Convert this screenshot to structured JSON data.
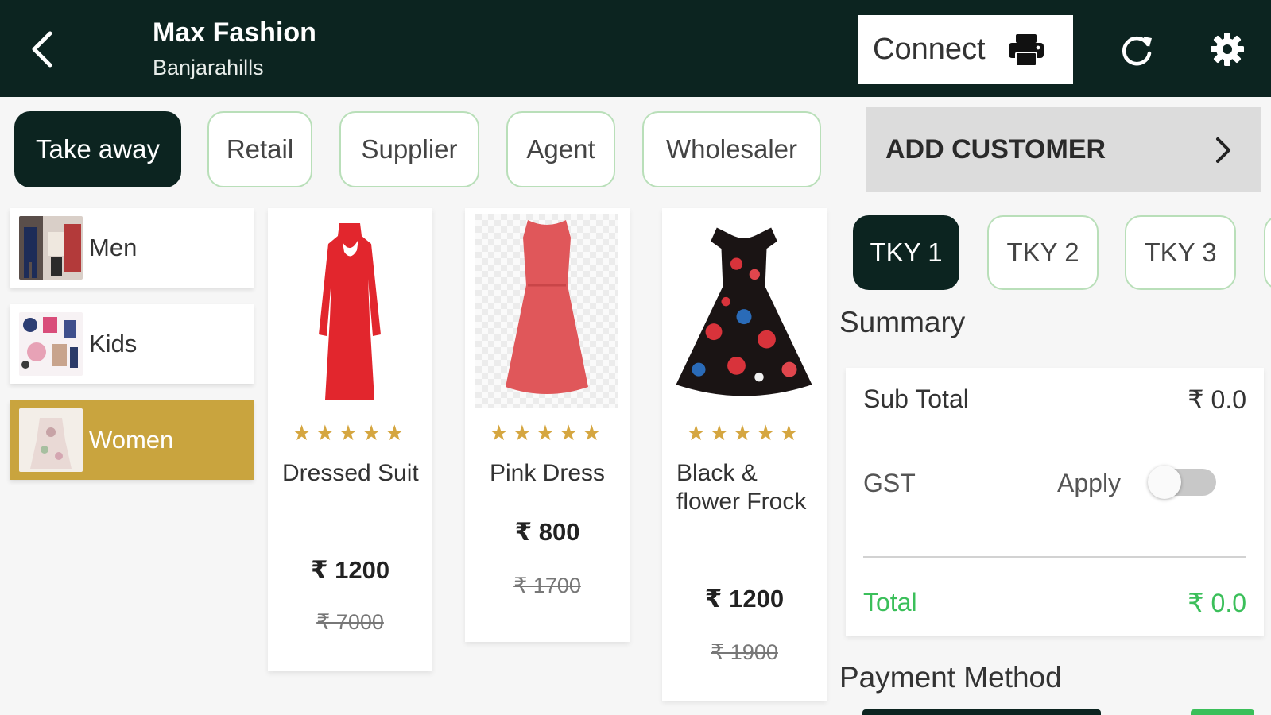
{
  "header": {
    "title": "Max Fashion",
    "subtitle": "Banjarahills",
    "connect_label": "Connect",
    "icons": [
      "back-arrow-icon",
      "printer-icon",
      "refresh-icon",
      "gear-icon"
    ]
  },
  "customer_types": [
    "Take away",
    "Retail",
    "Supplier",
    "Agent",
    "Wholesaler"
  ],
  "selected_customer_type": "Take away",
  "add_customer_label": "ADD CUSTOMER",
  "categories": [
    {
      "label": "Men"
    },
    {
      "label": "Kids"
    },
    {
      "label": "Women"
    }
  ],
  "selected_category": "Women",
  "products": [
    {
      "name": "Dressed Suit",
      "rating": 5,
      "price": "₹ 1200",
      "old_price": "₹ 7000"
    },
    {
      "name": "Pink Dress",
      "rating": 5,
      "price": "₹ 800",
      "old_price": "₹ 1700"
    },
    {
      "name": "Black & flower Frock",
      "rating": 5,
      "price": "₹ 1200",
      "old_price": "₹ 1900"
    }
  ],
  "takeaway_tabs": [
    "TKY 1",
    "TKY 2",
    "TKY 3"
  ],
  "selected_tab": "TKY 1",
  "summary": {
    "title": "Summary",
    "subtotal_label": "Sub Total",
    "subtotal_value": "₹ 0.0",
    "gst_label": "GST",
    "apply_label": "Apply",
    "gst_apply_on": false,
    "total_label": "Total",
    "total_value": "₹ 0.0"
  },
  "payment_method_title": "Payment Method",
  "stars_text": "★★★★★",
  "colors": {
    "header_bg": "#0c2420",
    "accent_gold": "#c9a43e",
    "chip_border": "#b9dfb9",
    "total_green": "#3bbf5a",
    "star": "#d5a640"
  }
}
